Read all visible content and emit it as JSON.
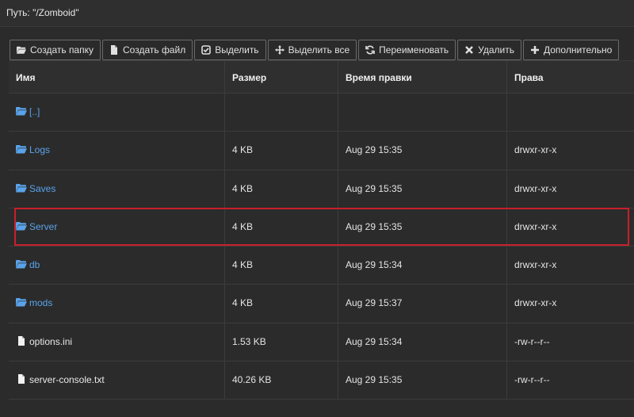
{
  "path": {
    "label": "Путь:",
    "value": "\"/Zomboid\""
  },
  "toolbar": {
    "buttons": [
      {
        "id": "create-folder",
        "label": "Создать папку",
        "icon": "folder-open-icon"
      },
      {
        "id": "create-file",
        "label": "Создать файл",
        "icon": "file-icon"
      },
      {
        "id": "select",
        "label": "Выделить",
        "icon": "check-square-icon"
      },
      {
        "id": "select-all",
        "label": "Выделить все",
        "icon": "move-arrows-icon"
      },
      {
        "id": "rename",
        "label": "Переименовать",
        "icon": "refresh-icon"
      },
      {
        "id": "delete",
        "label": "Удалить",
        "icon": "x-icon"
      },
      {
        "id": "more",
        "label": "Дополнительно",
        "icon": "plus-icon"
      }
    ]
  },
  "table": {
    "headers": {
      "name": "Имя",
      "size": "Размер",
      "time": "Время правки",
      "perm": "Права"
    },
    "rows": [
      {
        "name": "[..]",
        "type": "folder",
        "size": "",
        "time": "",
        "perm": ""
      },
      {
        "name": "Logs",
        "type": "folder",
        "size": "4 KB",
        "time": "Aug 29 15:35",
        "perm": "drwxr-xr-x"
      },
      {
        "name": "Saves",
        "type": "folder",
        "size": "4 KB",
        "time": "Aug 29 15:35",
        "perm": "drwxr-xr-x"
      },
      {
        "name": "Server",
        "type": "folder",
        "size": "4 KB",
        "time": "Aug 29 15:35",
        "perm": "drwxr-xr-x",
        "highlighted": true
      },
      {
        "name": "db",
        "type": "folder",
        "size": "4 KB",
        "time": "Aug 29 15:34",
        "perm": "drwxr-xr-x"
      },
      {
        "name": "mods",
        "type": "folder",
        "size": "4 KB",
        "time": "Aug 29 15:37",
        "perm": "drwxr-xr-x"
      },
      {
        "name": "options.ini",
        "type": "file",
        "size": "1.53 KB",
        "time": "Aug 29 15:34",
        "perm": "-rw-r--r--"
      },
      {
        "name": "server-console.txt",
        "type": "file",
        "size": "40.26 KB",
        "time": "Aug 29 15:35",
        "perm": "-rw-r--r--"
      }
    ]
  },
  "colors": {
    "link": "#5aa3ea",
    "highlight": "#c8202a",
    "background": "#2b2b2b"
  }
}
